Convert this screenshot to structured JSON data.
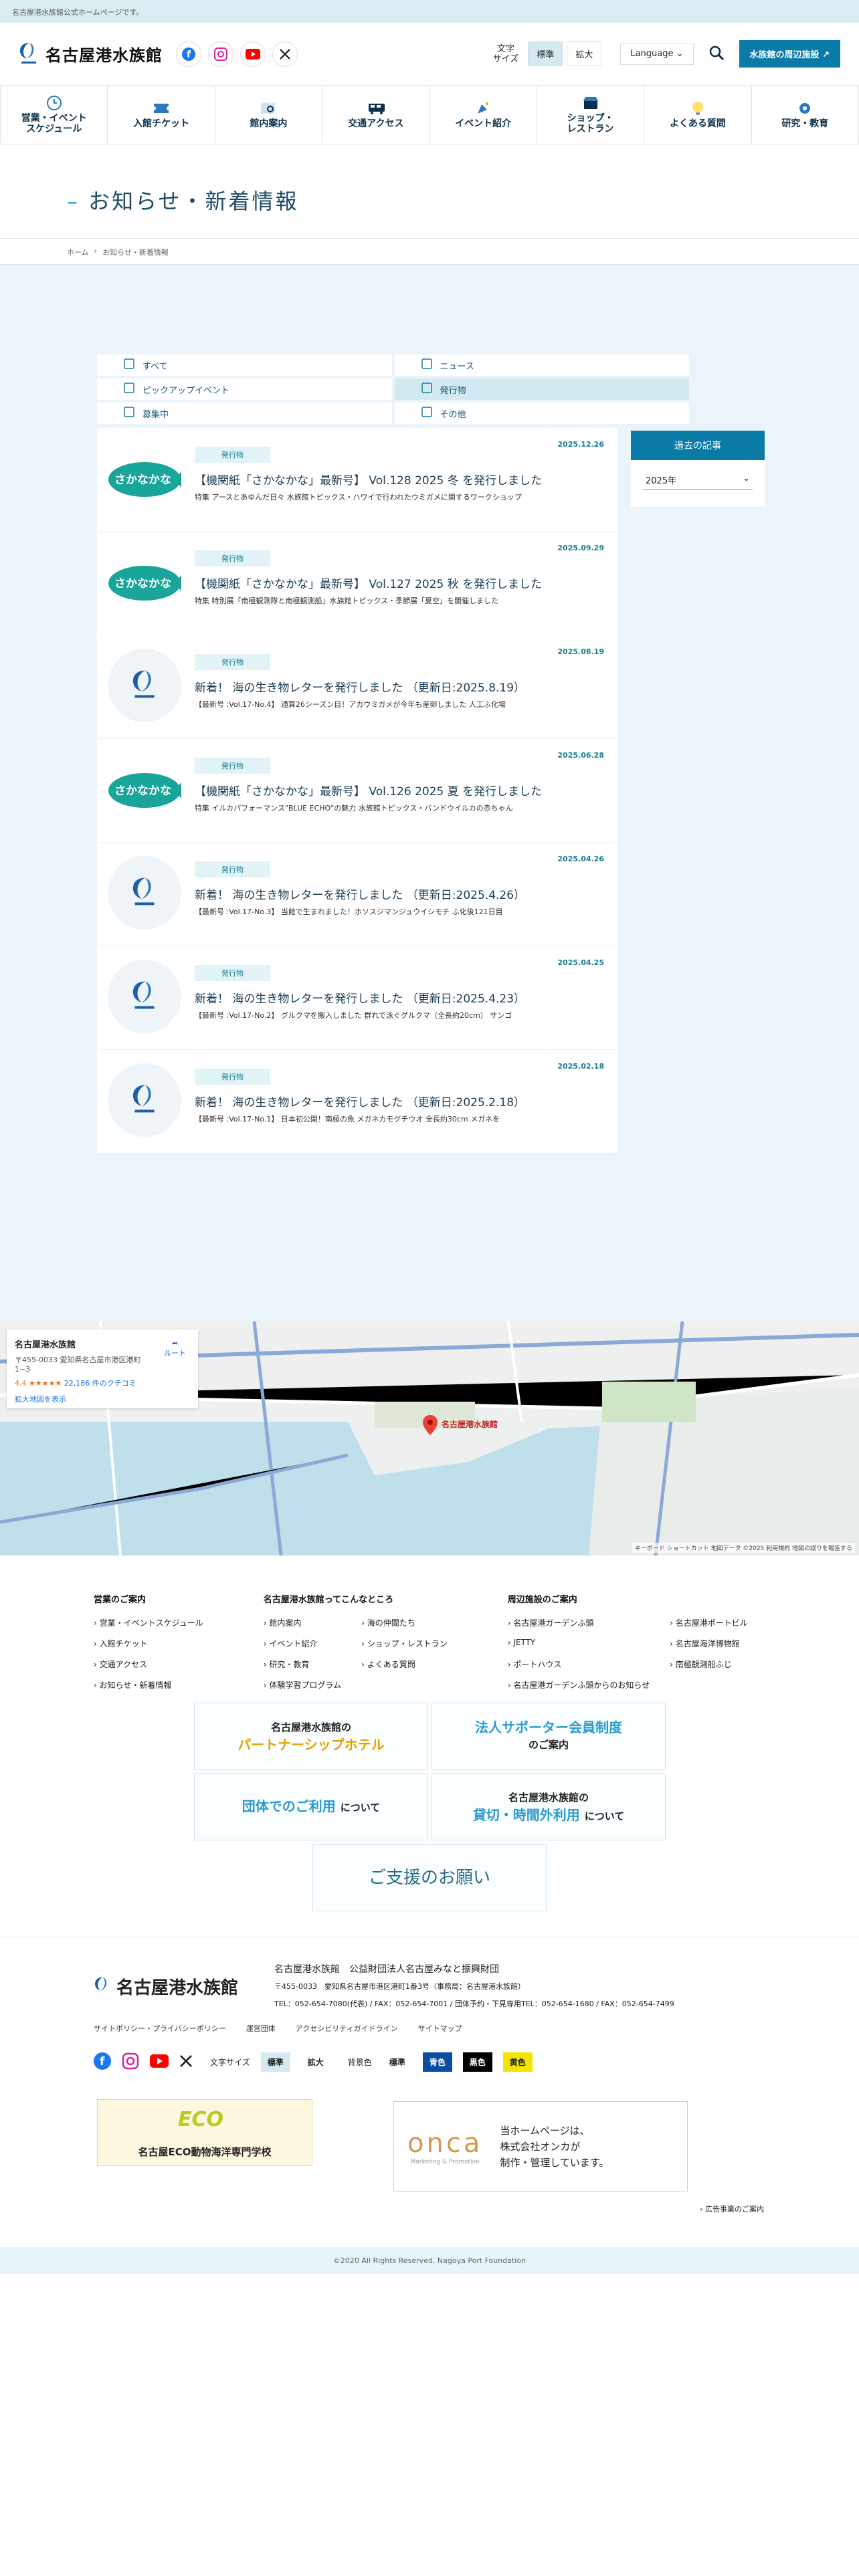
{
  "topbar": {
    "text": "名古屋港水族館公式ホームページです。"
  },
  "header": {
    "logo": "名古屋港水族館",
    "font_size_label": "文字\nサイズ",
    "font_standard": "標準",
    "font_large": "拡大",
    "language": "Language",
    "nearby_button": "水族館の周辺施設"
  },
  "nav": [
    {
      "label": "営業・イベント\nスケジュール",
      "icon": "clock-icon"
    },
    {
      "label": "入館チケット",
      "icon": "ticket-icon"
    },
    {
      "label": "館内案内",
      "icon": "map-search-icon"
    },
    {
      "label": "交通アクセス",
      "icon": "bus-icon"
    },
    {
      "label": "イベント紹介",
      "icon": "party-icon"
    },
    {
      "label": "ショップ・\nレストラン",
      "icon": "shop-icon"
    },
    {
      "label": "よくある質問",
      "icon": "question-icon"
    },
    {
      "label": "研究・教育",
      "icon": "research-icon"
    }
  ],
  "page_title": "お知らせ・新着情報",
  "breadcrumb": {
    "home": "ホーム",
    "current": "お知らせ・新着情報"
  },
  "filters": [
    {
      "label": "すべて",
      "selected": false
    },
    {
      "label": "ニュース",
      "selected": false
    },
    {
      "label": "ピックアップイベント",
      "selected": false
    },
    {
      "label": "発行物",
      "selected": true
    },
    {
      "label": "募集中",
      "selected": false
    },
    {
      "label": "その他",
      "selected": false
    }
  ],
  "articles": [
    {
      "date": "2025.12.26",
      "tag": "発行物",
      "title": "【機関紙「さかなかな」最新号】 Vol.128 2025 冬 を発行しました",
      "desc": "特集 アースとあゆんだ日々 水族館トピックス・ハワイで行われたウミガメに関するワークショップ",
      "thumb": "sakanakana"
    },
    {
      "date": "2025.09.29",
      "tag": "発行物",
      "title": "【機関紙「さかなかな」最新号】 Vol.127 2025 秋 を発行しました",
      "desc": "特集 特別展「南極観測隊と南極観測船」水族館トピックス・季節展「夏空」を開催しました",
      "thumb": "sakanakana"
    },
    {
      "date": "2025.08.19",
      "tag": "発行物",
      "title": "新着！ 海の生き物レターを発行しました （更新日:2025.8.19）",
      "desc": "【最新号 :Vol.17-No.4】 通算26シーズン目！アカウミガメが今年も産卵しました 人工ふ化場",
      "thumb": "logo"
    },
    {
      "date": "2025.06.28",
      "tag": "発行物",
      "title": "【機関紙「さかなかな」最新号】 Vol.126 2025 夏 を発行しました",
      "desc": "特集 イルカパフォーマンス\"BLUE ECHO\"の魅力 水族館トピックス・バンドウイルカの赤ちゃん",
      "thumb": "sakanakana"
    },
    {
      "date": "2025.04.26",
      "tag": "発行物",
      "title": "新着！ 海の生き物レターを発行しました （更新日:2025.4.26）",
      "desc": "【最新号 :Vol.17-No.3】 当館で生まれました！ホソスジマンジュウイシモチ ふ化後121日目",
      "thumb": "logo"
    },
    {
      "date": "2025.04.25",
      "tag": "発行物",
      "title": "新着！ 海の生き物レターを発行しました （更新日:2025.4.23）",
      "desc": "【最新号 :Vol.17-No.2】 グルクマを搬入しました 群れで泳ぐグルクマ（全長約20cm） サンゴ",
      "thumb": "logo"
    },
    {
      "date": "2025.02.18",
      "tag": "発行物",
      "title": "新着！ 海の生き物レターを発行しました （更新日:2025.2.18）",
      "desc": "【最新号 :Vol.17-No.1】 日本初公開！南極の魚 メガネカモグチウオ 全長約30cm メガネを",
      "thumb": "logo"
    }
  ],
  "sidebar": {
    "heading": "過去の記事",
    "year": "2025年"
  },
  "map": {
    "name": "名古屋港水族館",
    "address": "〒455-0033 愛知県名古屋市港区港町1−3",
    "route": "ルート",
    "rating": "4.4 ★★★★★",
    "reviews": "22,186 件のクチコミ",
    "enlarge": "拡大地図を表示",
    "pin_label": "名古屋港水族館",
    "credits": "キーボード ショートカット  地図データ ©2025  利用規約  地図の誤りを報告する"
  },
  "footer_nav": [
    {
      "heading": "営業のご案内",
      "items": [
        "営業・イベントスケジュール",
        "入館チケット",
        "交通アクセス",
        "お知らせ・新着情報"
      ]
    },
    {
      "heading": "名古屋港水族館ってこんなところ",
      "items": [
        "館内案内",
        "海の仲間たち",
        "イベント紹介",
        "ショップ・レストラン",
        "研究・教育",
        "よくある質問",
        "体験学習プログラム"
      ]
    },
    {
      "heading": "周辺施設のご案内",
      "items": [
        "名古屋港ガーデンふ頭",
        "名古屋港ポートビル",
        "JETTY",
        "名古屋海洋博物館",
        "ポートハウス",
        "南極観測船ふじ",
        "名古屋港ガーデンふ頭からのお知らせ"
      ]
    }
  ],
  "banners": {
    "hotel_pre": "名古屋港水族館の",
    "hotel": "パートナーシップホテル",
    "sponsor": "法人サポーター会員制度",
    "sponsor_post": "のご案内",
    "group": "団体でのご利用",
    "group_post": "について",
    "rental_pre": "名古屋港水族館の",
    "rental": "貸切・時間外利用",
    "rental_post": "について",
    "support": "ご支援のお願い"
  },
  "footer": {
    "logo": "名古屋港水族館",
    "org": "名古屋港水族館　公益財団法人名古屋みなと振興財団",
    "addr": "〒455-0033　愛知県名古屋市港区港町1番3号（事務局：名古屋港水族館）",
    "tel": "TEL：052-654-7080(代表) / FAX：052-654-7001 / 団体予約・下見専用TEL：052-654-1680 / FAX：052-654-7499",
    "links": [
      "サイトポリシー・プライバシーポリシー",
      "運営団体",
      "アクセシビリティガイドライン",
      "サイトマップ"
    ],
    "font_size": "文字サイズ",
    "standard": "標準",
    "large": "拡大",
    "bg_color": "背景色",
    "c_standard": "標準",
    "c_blue": "青色",
    "c_black": "黒色",
    "c_yellow": "黄色",
    "eco_banner": "名古屋ECO動物海洋専門学校",
    "onca_logo": "onca",
    "onca_sub": "Marketing & Promotion",
    "onca_text": "当ホームページは、\n株式会社オンカが\n制作・管理しています。",
    "ad_link": "広告事業のご案内",
    "copyright": "©2020 All Rights Reserved. Nagoya Port Foundation"
  }
}
